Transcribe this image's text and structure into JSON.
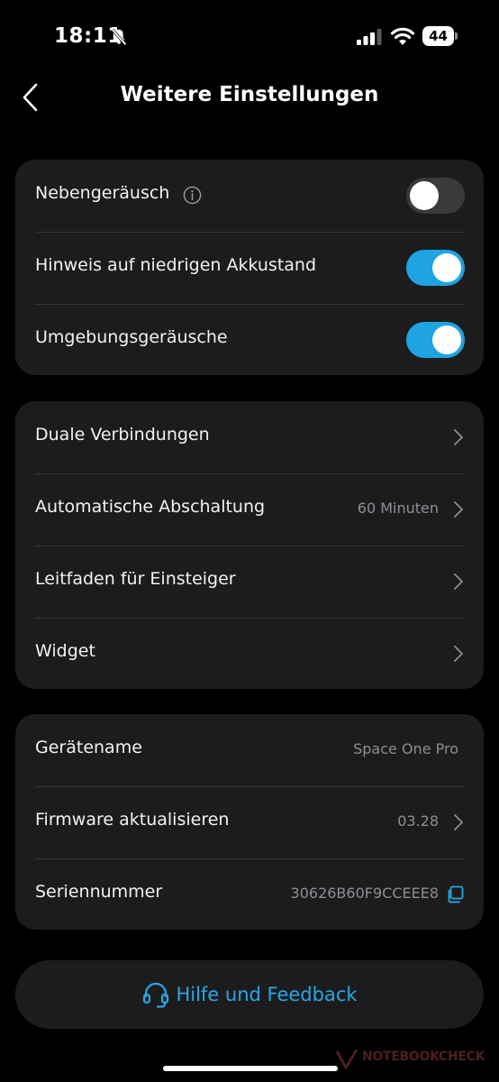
{
  "status_bar": {
    "time": "18:11",
    "battery": "44",
    "icons": [
      "bell-slash-icon",
      "signal-icon",
      "wifi-icon",
      "battery-icon"
    ]
  },
  "header": {
    "back_icon": "chevron-left-icon",
    "title": "Weitere Einstellungen"
  },
  "section1": {
    "items": [
      {
        "label": "Nebengeräusch",
        "has_info": true,
        "toggle": "off"
      },
      {
        "label": "Hinweis auf niedrigen Akkustand",
        "toggle": "on"
      },
      {
        "label": "Umgebungsgeräusche",
        "toggle": "on"
      }
    ]
  },
  "section2": {
    "items": [
      {
        "label": "Duale Verbindungen",
        "value": ""
      },
      {
        "label": "Automatische Abschaltung",
        "value": "60 Minuten"
      },
      {
        "label": "Leitfaden für Einsteiger",
        "value": ""
      },
      {
        "label": "Widget",
        "value": ""
      }
    ]
  },
  "section3": {
    "items": [
      {
        "label": "Gerätename",
        "value": "Space One Pro"
      },
      {
        "label": "Firmware aktualisieren",
        "value": "03.28"
      },
      {
        "label": "Seriennummer",
        "value": "30626B60F9CCEEE8"
      }
    ]
  },
  "help": {
    "label": "Hilfe und Feedback",
    "icon": "headset-icon"
  },
  "watermark": {
    "text": "NOTEBOOKCHECK"
  },
  "colors": {
    "accent": "#27a8e6",
    "toggle_on": "#1ea4e0",
    "card_bg": "#1c1c1e",
    "background": "#000000"
  }
}
